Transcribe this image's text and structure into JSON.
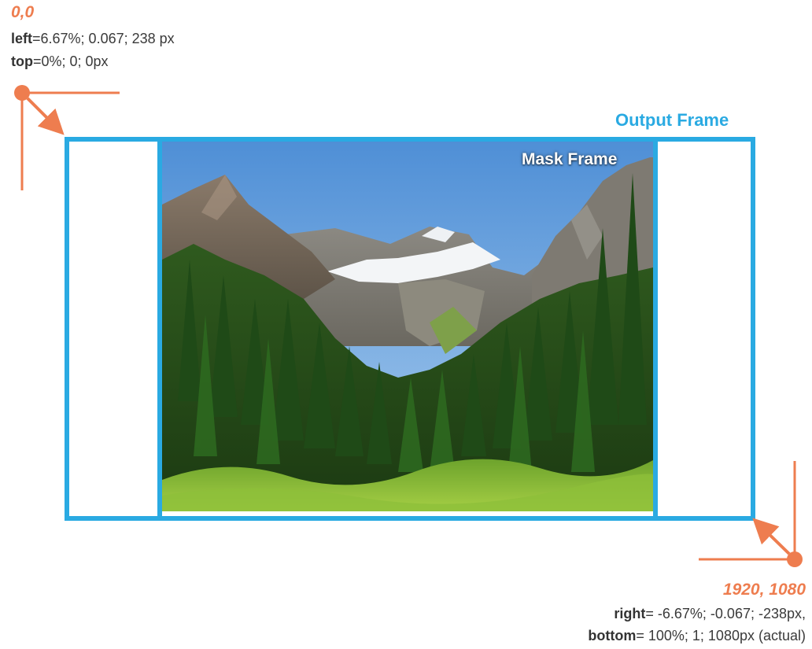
{
  "origin": {
    "title": "0,0",
    "left_key": "left",
    "left_value": "=6.67%; 0.067; 238 px",
    "top_key": "top",
    "top_value": "=0%; 0; 0px"
  },
  "end": {
    "title": "1920, 1080",
    "right_key": "right",
    "right_value": "= -6.67%; -0.067; -238px,",
    "bottom_key": "bottom",
    "bottom_value": "= 100%; 1; 1080px (actual)"
  },
  "labels": {
    "output_frame": "Output Frame",
    "mask_frame": "Mask Frame"
  },
  "colors": {
    "accent_orange": "#ee7d4f",
    "frame_blue": "#2aaae2"
  },
  "image": {
    "subject": "mountain-valley-forest-photo"
  }
}
